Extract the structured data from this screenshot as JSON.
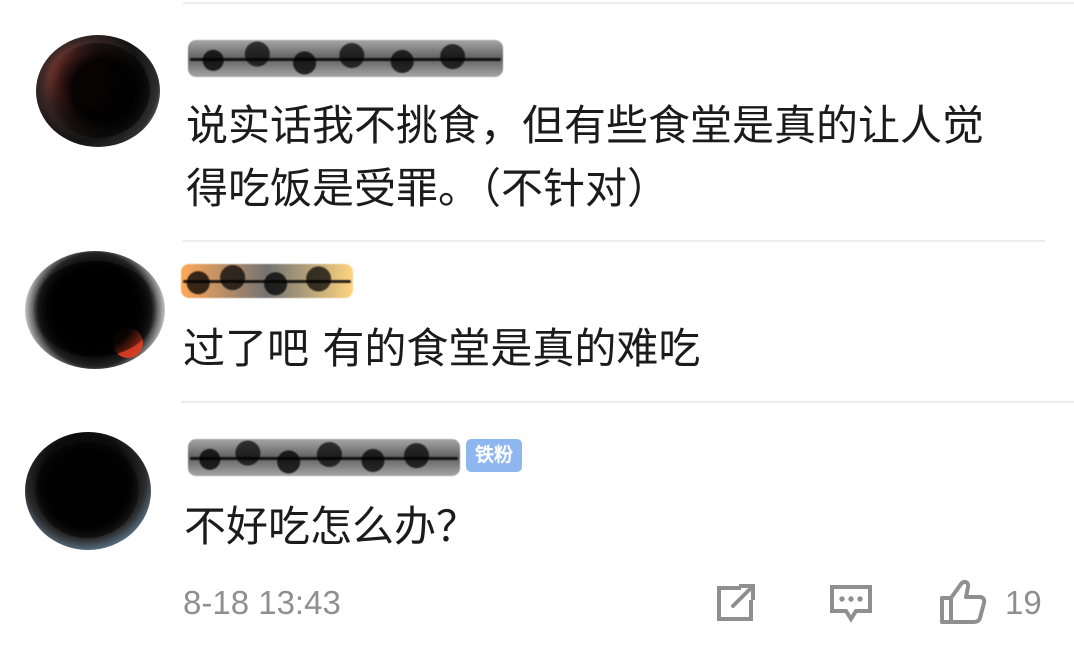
{
  "comments": [
    {
      "author": "",
      "text_line1": "说实话我不挑食，但有些食堂是真的让人觉",
      "text_line2": "得吃饭是受罪。（不针对）"
    },
    {
      "author": "",
      "text": "过了吧 有的食堂是真的难吃"
    },
    {
      "author": "",
      "badge": "铁粉",
      "text": "不好吃怎么办？"
    }
  ],
  "footer": {
    "timestamp": "8-18 13:43",
    "like_count": "19",
    "icons": [
      "share-icon",
      "comment-icon",
      "like-icon"
    ]
  },
  "colors": {
    "text": "#1b1b1b",
    "muted": "#8f8f8f",
    "divider": "#ececec",
    "badge": "#8eb7ef"
  }
}
